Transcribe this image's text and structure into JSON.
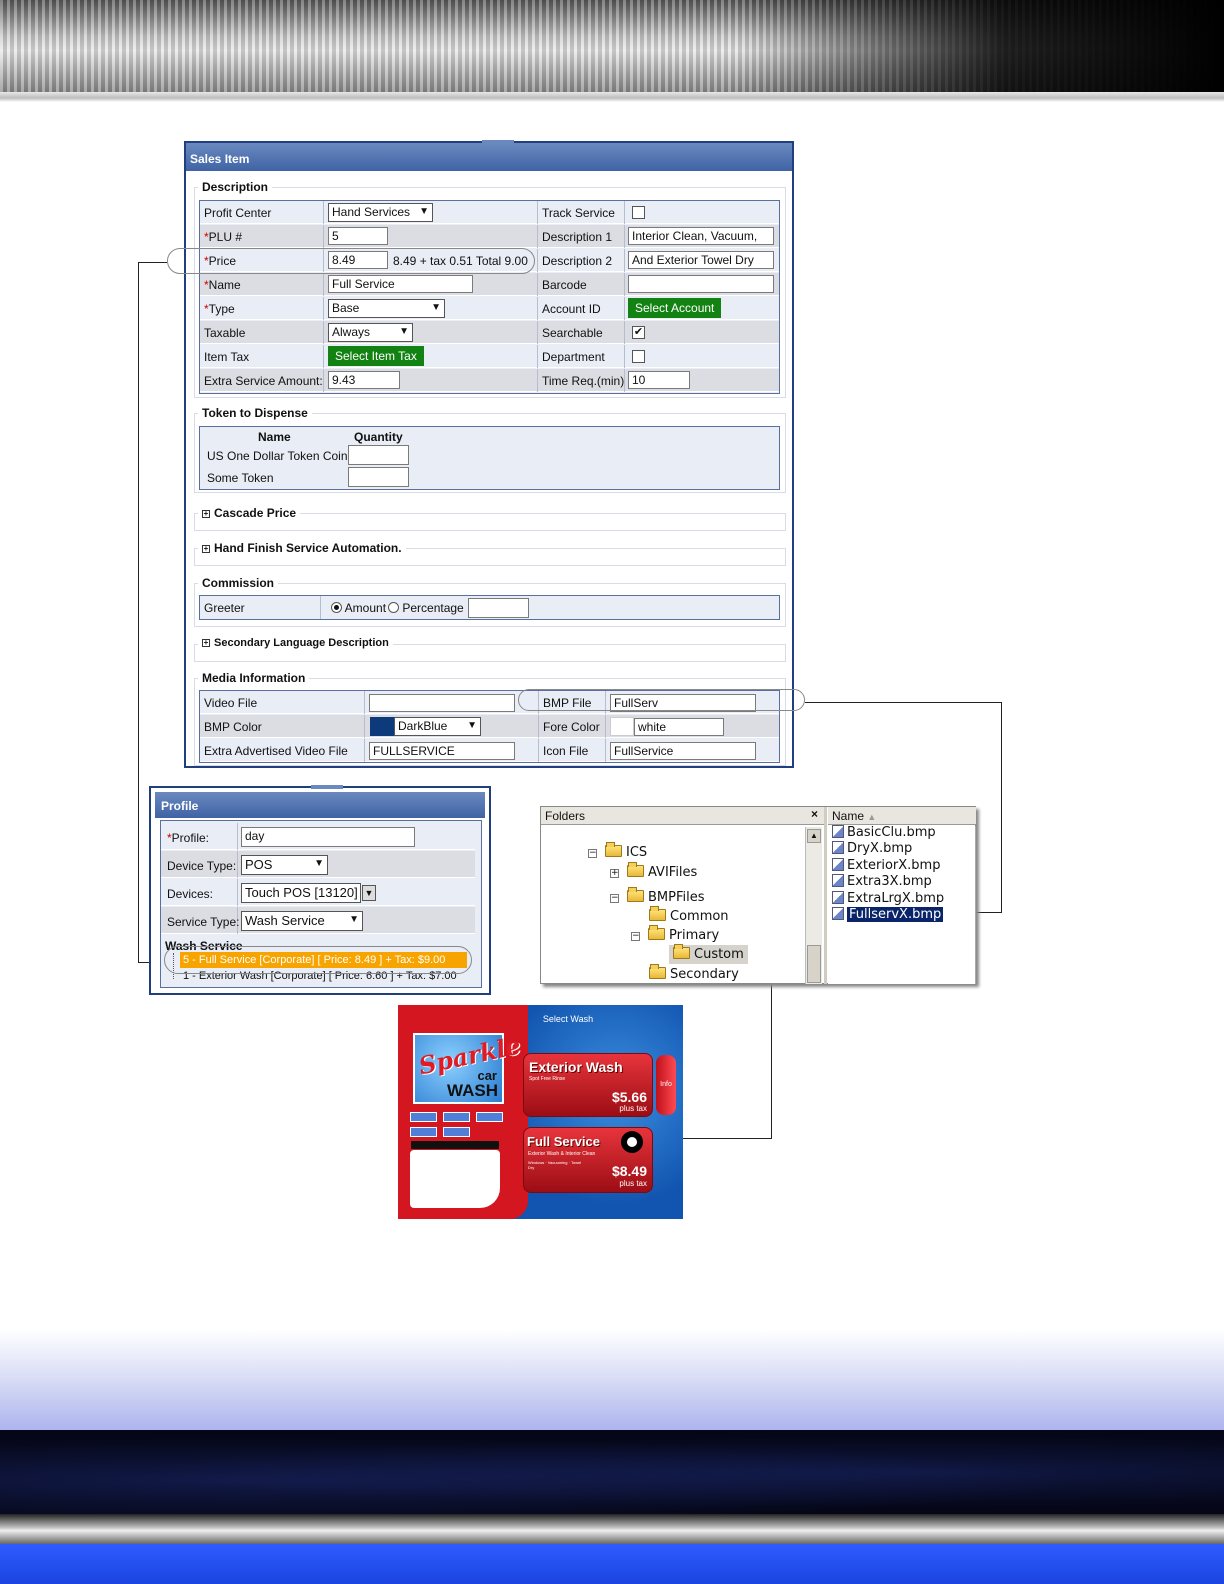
{
  "sales_item": {
    "title": "Sales Item",
    "description": {
      "legend": "Description",
      "left": [
        {
          "label": "Profit Center",
          "required": false,
          "value": "Hand Services",
          "kind": "select"
        },
        {
          "label": "PLU #",
          "required": true,
          "value": "5",
          "kind": "input"
        },
        {
          "label": "Price",
          "required": true,
          "value": "8.49",
          "kind": "input",
          "note": "8.49 + tax 0.51 Total 9.00"
        },
        {
          "label": "Name",
          "required": true,
          "value": "Full Service",
          "kind": "input"
        },
        {
          "label": "Type",
          "required": true,
          "value": "Base",
          "kind": "select"
        },
        {
          "label": "Taxable",
          "required": false,
          "value": "Always",
          "kind": "select"
        },
        {
          "label": "Item Tax",
          "required": false,
          "value": "Select Item Tax",
          "kind": "button"
        },
        {
          "label": "Extra Service Amount:",
          "required": false,
          "value": "9.43",
          "kind": "input"
        }
      ],
      "right": [
        {
          "label": "Track Service",
          "value": "",
          "kind": "checkbox",
          "checked": false
        },
        {
          "label": "Description 1",
          "value": "Interior  Clean, Vacuum,",
          "kind": "input"
        },
        {
          "label": "Description 2",
          "value": "And Exterior Towel Dry",
          "kind": "input"
        },
        {
          "label": "Barcode",
          "value": "",
          "kind": "input"
        },
        {
          "label": "Account ID",
          "value": "Select Account",
          "kind": "button"
        },
        {
          "label": "Searchable",
          "value": "",
          "kind": "checkbox",
          "checked": true
        },
        {
          "label": "Department",
          "value": "",
          "kind": "checkbox",
          "checked": false
        },
        {
          "label": "Time Req.(min)",
          "value": "10",
          "kind": "input"
        }
      ]
    },
    "token": {
      "legend": "Token to Dispense",
      "col_name": "Name",
      "col_qty": "Quantity",
      "rows": [
        {
          "name": "US One Dollar Token Coin",
          "qty": ""
        },
        {
          "name": "Some Token",
          "qty": ""
        }
      ]
    },
    "cascade_price": "Cascade Price",
    "hand_finish": "Hand Finish Service Automation.",
    "commission": {
      "legend": "Commission",
      "label": "Greeter",
      "opt_amount": "Amount",
      "opt_percentage": "Percentage",
      "value": ""
    },
    "secondary_language": "Secondary Language Description",
    "media": {
      "legend": "Media Information",
      "rows": [
        {
          "l_label": "Video File",
          "l_value": "",
          "r_label": "BMP File",
          "r_value": "FullServ"
        },
        {
          "l_label": "BMP Color",
          "l_value": "DarkBlue",
          "l_swatch": "#0c3a7a",
          "r_label": "Fore Color",
          "r_value": "white"
        },
        {
          "l_label": "Extra Advertised Video File",
          "l_value": "FULLSERVICE",
          "r_label": "Icon File",
          "r_value": "FullService"
        }
      ]
    }
  },
  "profile": {
    "title": "Profile",
    "rows": [
      {
        "label": "Profile:",
        "required": true,
        "value": "day",
        "kind": "input"
      },
      {
        "label": "Device Type:",
        "required": false,
        "value": "POS",
        "kind": "select"
      },
      {
        "label": "Devices:",
        "required": false,
        "value": "Touch POS [13120]",
        "kind": "select-small"
      },
      {
        "label": "Service Type:",
        "required": false,
        "value": "Wash Service",
        "kind": "select"
      }
    ],
    "wash_service_label": "Wash Service",
    "wash_items": [
      "5 - Full Service [Corporate]  [ Price: 8.49 ] + Tax: $9.00",
      "1 - Exterior Wash [Corporate]  [ Price: 6.60 ] + Tax: $7.00"
    ]
  },
  "explorer": {
    "folders_title": "Folders",
    "close_glyph": "×",
    "name_col": "Name",
    "tree": [
      {
        "label": "ICS",
        "expander": "−"
      },
      {
        "label": "AVIFiles",
        "expander": "+"
      },
      {
        "label": "BMPFiles",
        "expander": "−"
      },
      {
        "label": "Common",
        "expander": ""
      },
      {
        "label": "Primary",
        "expander": "−"
      },
      {
        "label": "Custom",
        "expander": ""
      },
      {
        "label": "Secondary",
        "expander": ""
      }
    ],
    "files": [
      "BasicClu.bmp",
      "DryX.bmp",
      "ExteriorX.bmp",
      "Extra3X.bmp",
      "ExtraLrgX.bmp",
      "FullservX.bmp"
    ]
  },
  "kiosk": {
    "header": "Select Wash",
    "logo_line1": "Sparkle",
    "logo_line2": "car",
    "logo_line3": "WASH",
    "info_label": "Info",
    "option1_title": "Exterior Wash",
    "option1_sub": "Spot Free Rinse",
    "option1_price": "$5.66",
    "option1_tax": "plus tax",
    "option2_title": "Full Service",
    "option2_sub": "Exterior Wash & Interior Clean",
    "option2_sub2": "Windows · Vacuuming · Towel Dry",
    "option2_price": "$8.49",
    "option2_tax": "plus tax"
  }
}
